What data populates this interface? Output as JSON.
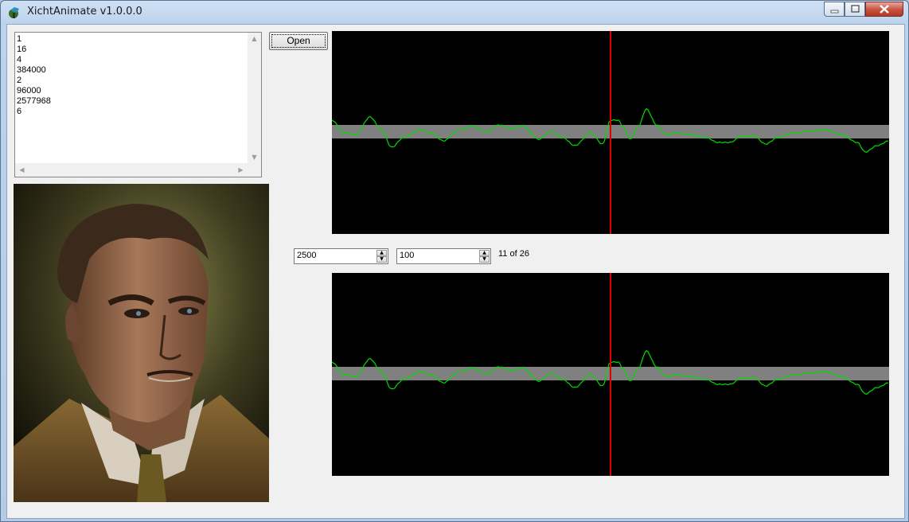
{
  "window": {
    "title": "XichtAnimate v1.0.0.0"
  },
  "listbox": {
    "items": [
      "1",
      "16",
      "4",
      "384000",
      "2",
      "96000",
      "2577968",
      "6"
    ]
  },
  "toolbar": {
    "open_label": "Open"
  },
  "controls": {
    "spinner_a_value": "2500",
    "spinner_b_value": "100",
    "frame_counter": "11 of 26"
  },
  "waveform_view": {
    "background": "#000000",
    "signal_color": "#00dc00",
    "band_color": "#808080",
    "cursor_color": "#e00000",
    "cursor_position_fraction": 0.5
  }
}
